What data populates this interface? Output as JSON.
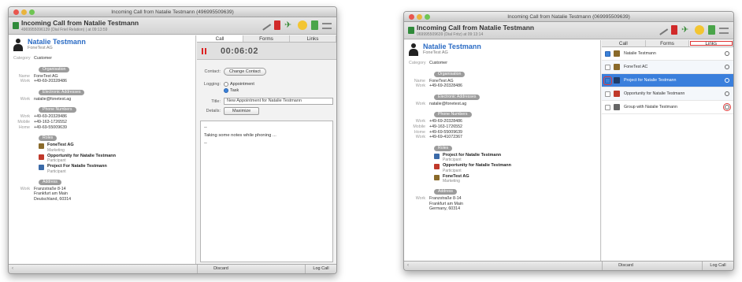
{
  "window1": {
    "title": "Incoming Call from Natalie Testmann (496995509639)",
    "call_title": "Incoming Call from Natalie Testmann",
    "call_subtitle": "4969955096139 (Dial Friel Relation) | at 09:13:59",
    "person": {
      "name": "Natalie Testmann",
      "company": "FoneTest AG"
    },
    "category": {
      "label": "Category",
      "value": "Customer"
    },
    "sections": {
      "organisation": {
        "title": "Organisation",
        "rows": [
          {
            "k": "Name",
            "v": "FoneTest AG"
          },
          {
            "k": "Work",
            "v": "+49-69-20328486"
          }
        ]
      },
      "email": {
        "title": "Electronic Addresses",
        "rows": [
          {
            "k": "Work",
            "v": "natalie@fonetest.ag"
          }
        ]
      },
      "phone": {
        "title": "Phone Numbers",
        "rows": [
          {
            "k": "Work",
            "v": "+49-69-20328486"
          },
          {
            "k": "Mobile",
            "v": "+49-163-1726552"
          },
          {
            "k": "Home",
            "v": "+49-69-55009639"
          }
        ]
      },
      "roles": {
        "title": "Roles",
        "items": [
          {
            "t1": "FoneTest AG",
            "t2": "Marketing",
            "icon": "company"
          },
          {
            "t1": "Opportunity for Natalie Testmann",
            "t2": "Participant",
            "icon": "opp"
          },
          {
            "t1": "Project For Natalie Testmann",
            "t2": "Participant",
            "icon": "proj"
          }
        ]
      },
      "address": {
        "title": "Address",
        "k": "Work",
        "lines": [
          "Franzstraße 8-14",
          "Frankfurt am Main",
          "Deutschland, 60314"
        ]
      }
    },
    "tabs": [
      "Call",
      "Forms",
      "Links"
    ],
    "timer": "00:06:02",
    "contact_label": "Contact:",
    "change_contact": "Change Contact",
    "logging_label": "Logging:",
    "radio_appointment": "Appointment",
    "radio_task": "Task",
    "title_label": "Title:",
    "title_value": "New Appointment for Natalie Testmann",
    "details_label": "Details:",
    "maximize": "Maximize",
    "notes": [
      "--",
      "Taking some notes while phoning ...",
      "--"
    ],
    "discard": "Discard",
    "log_call": "Log Call"
  },
  "window2": {
    "title": "Incoming Call from Natalie Testmann (069995509639)",
    "call_title": "Incoming Call from Natalie Testmann",
    "call_subtitle": "069995509639 (Dial Fritz) at 09:13:14",
    "person": {
      "name": "Natalie Testmann",
      "company": "FoneTest AG"
    },
    "category": {
      "label": "Category",
      "value": "Customer"
    },
    "sections": {
      "organisation": {
        "title": "Organisation",
        "rows": [
          {
            "k": "Name",
            "v": "FoneTest AG"
          },
          {
            "k": "Work",
            "v": "+49-69-20328486"
          }
        ]
      },
      "email": {
        "title": "Electronic Addresses",
        "rows": [
          {
            "k": "Work",
            "v": "natalie@fonetest.ag"
          }
        ]
      },
      "phone": {
        "title": "Phone Numbers",
        "rows": [
          {
            "k": "Work",
            "v": "+49-69-20328486"
          },
          {
            "k": "Mobile",
            "v": "+49-163-1726552"
          },
          {
            "k": "Home",
            "v": "+49-69-55009639"
          },
          {
            "k": "Work",
            "v": "+49-69-41072367"
          }
        ]
      },
      "roles": {
        "title": "Roles",
        "items": [
          {
            "t1": "Project for Natalie Testmann",
            "t2": "Participant",
            "icon": "proj"
          },
          {
            "t1": "Opportunity for Natalie Testmann",
            "t2": "Participant",
            "icon": "opp"
          },
          {
            "t1": "FoneTest AG",
            "t2": "Marketing",
            "icon": "company"
          }
        ]
      },
      "address": {
        "title": "Address",
        "k": "Work",
        "lines": [
          "Franzstraße 8-14",
          "Frankfurt am Main",
          "Germany, 60314"
        ]
      }
    },
    "tabs": [
      "Call",
      "Forms",
      "Links"
    ],
    "links": [
      {
        "label": "Natalie Testmann",
        "checked": true,
        "icon_color": "#8a6a2a"
      },
      {
        "label": "FoneTest AC",
        "checked": false,
        "icon_color": "#8a6a2a"
      },
      {
        "label": "Project for Natalie Testmann",
        "checked": true,
        "icon_color": "#3b6aa8",
        "selected": true
      },
      {
        "label": "Opportunity for Natalie Testmann",
        "checked": false,
        "icon_color": "#c0392b"
      },
      {
        "label": "Group with Natalie Testmann",
        "checked": false,
        "icon_color": "#666666"
      }
    ],
    "discard": "Discard",
    "log_call": "Log Call"
  }
}
